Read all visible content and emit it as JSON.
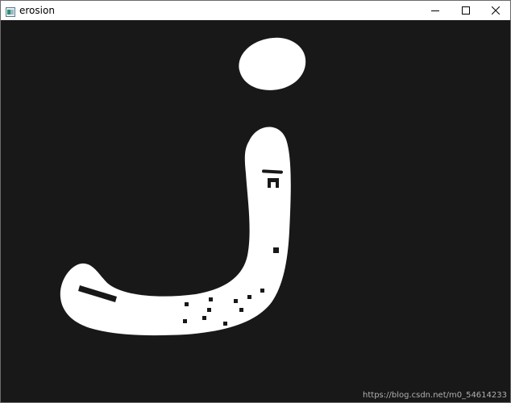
{
  "window": {
    "title": "erosion",
    "controls": {
      "minimize": "minimize-icon",
      "maximize": "maximize-icon",
      "close": "close-icon"
    }
  },
  "canvas": {
    "background": "#181818",
    "foreground": "#ffffff",
    "depicted_glyph": "j",
    "watermark": "https://blog.csdn.net/m0_54614233"
  }
}
